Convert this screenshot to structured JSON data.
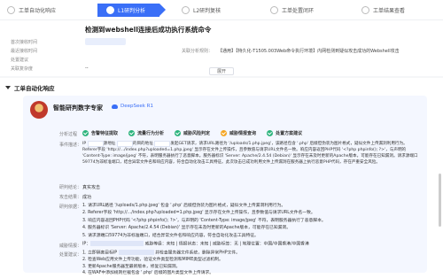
{
  "flow": {
    "tabs": [
      {
        "label": "工单自动化响应",
        "active": false
      },
      {
        "label": "L1研判分析",
        "active": true
      },
      {
        "label": "L2研判复核",
        "active": false
      },
      {
        "label": "工单处置闭环",
        "active": false
      },
      {
        "label": "工单结果查看",
        "active": false
      }
    ]
  },
  "detail": {
    "title": "检测到webshell连接后成功执行系统命令",
    "fields": [
      {
        "label": "首次接收时间"
      },
      {
        "label": "最近接收时间"
      },
      {
        "label": "处置建议"
      },
      {
        "label": "关联复杂度",
        "value": "--"
      },
      {
        "label": "关联报告等",
        "link": "网络威胁监测"
      }
    ],
    "rule_label": "关联分析规则：",
    "rule_value": "【通用】【特久化-T1505.003Web命令执行环境】内网检测到疑似攻击成功的Webshell攻击",
    "collapse_label": "展开"
  },
  "section": {
    "title": "工单自动化响应",
    "card": {
      "name": "智能研判数字专家",
      "engine": "DeepSeek R1",
      "process_label": "分析过程",
      "steps": [
        {
          "label": "告警特征提取",
          "state": "done"
        },
        {
          "label": "流量行为分析",
          "state": "done"
        },
        {
          "label": "威胁风险判定",
          "state": "done"
        },
        {
          "label": "威胁情报查询",
          "state": "warn"
        },
        {
          "label": "处置方案建议",
          "state": "done"
        }
      ],
      "desc_label": "事件描述：",
      "desc_p1a": "IP ",
      "desc_p1b": " 源地址 ",
      "desc_p1c": " 的目的地址 ",
      "desc_p1d": " 发起GET请求，请求URL路径为 '/uploads/1.php.jpeg'，该路径包含 '.php' 后缀但伪装为图片格式，疑似文件上传漏洞利用行为。Referer字段 'http://.../index.php?uploaded=1.php.jpeg' 显示存在文件上传操作，且参数值与请求URL文件名一致。响应内容返回PHP代码 '<?php phpinfo(); ?>'，与声明的 'Content-Type: image/jpeg' 不符，表明服务器执行了恶意脚本。服务器标识 'Server: Apache/2.4.54 (Debian)' 显示存在未及时更新的Apache版本，可能存在已知漏洞。请求源端口59774为非标准端口，结合异常文件名和响应内容，符合自动化攻击工具特征。此次攻击已成功利用文件上传漏洞在服务器上执行恶意PHP代码，存在严重安全风险。",
      "conclusion_label": "研判结论：",
      "conclusion_value": "真实攻击",
      "result_label": "攻击结果：",
      "result_value": "成功",
      "reason_label": "研判依据：",
      "reasons": [
        "1. 请求URL路径 '/uploads/1.php.jpeg' 包含 '.php' 后缀但伪装为图片格式，疑似文件上传漏洞利用行为。",
        "2. Referer字段 'http://.../index.php?uploaded=1.php.jpeg' 显示存在文件上传操作，且参数值与请求URL文件名一致。",
        "3. 响应内容返回PHP代码 '<?php phpinfo(); ?>'，与声明的 'Content-Type: image/jpeg' 不符，表明服务器执行了恶意脚本。",
        "4. 服务器标识 'Server: Apache/2.4.54 (Debian)' 显示存在未及时更新的Apache版本，可能存在已知漏洞。",
        "5. 请求源端口59774为非标准端口，结合异常文件名和响应内容，符合自动化攻击工具特征。"
      ],
      "intel_label": "威胁情报：",
      "intel_value": "IP：",
      "intel_rest": "威胁等级：未知 | 情报状态：未知 | 威胁标签：无 | 地理位置：中国/中国香港/中国香港",
      "advice_label": "处置建议：",
      "advice": [
        "1. 立即隔离目标IP ",
        "2. 检查Web应用文件上传功能，验证文件类型检测和MIME类型过滤机制。",
        "3. 更新Apache服务器至最新版本，修复已知漏洞。",
        "4. 在WAF中添加规则拦截包含 '.php' 后缀的图片类型文件上传请求。",
        "5. 对服务器进行完整日志审计，确认是否存在后续攻击行为。"
      ],
      "advice1_tail": " 并检查服务器文件系统，删除异常PHP文件。"
    }
  }
}
